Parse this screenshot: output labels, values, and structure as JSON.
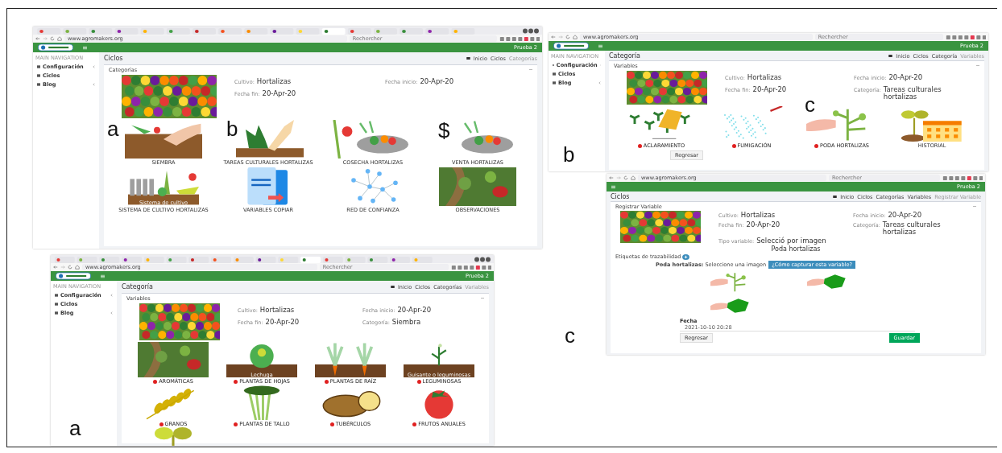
{
  "annotations": [
    {
      "text": "a"
    },
    {
      "text": "b"
    },
    {
      "text": "$"
    },
    {
      "text": "b"
    },
    {
      "text": "c"
    },
    {
      "text": "c"
    },
    {
      "text": "a"
    }
  ],
  "panels": [
    {
      "kind": "categories",
      "tab_strip": true,
      "address": {
        "url": "www.agromakers.org",
        "search_placeholder": "Rechercher"
      },
      "header": {
        "logo": true,
        "user": "Prueba 2"
      },
      "sidebar": {
        "heading": "MAIN NAVIGATION",
        "items": [
          {
            "label": "Configuración",
            "expandable": true
          },
          {
            "label": "Ciclos",
            "expandable": false
          },
          {
            "label": "Blog",
            "expandable": true
          }
        ]
      },
      "page_title": "Ciclos",
      "breadcrumbs": [
        {
          "label": "Inicio",
          "current": false
        },
        {
          "label": "Ciclos",
          "current": false
        },
        {
          "label": "Categorías",
          "current": true
        }
      ],
      "card_title": "Categorías",
      "info": [
        {
          "label": "Cultivo:",
          "value": "Hortalizas"
        },
        {
          "label": "Fecha inicio:",
          "value": "20-Apr-20"
        },
        {
          "label": "Fecha fin:",
          "value": "20-Apr-20"
        }
      ],
      "items": [
        {
          "label": "SIEMBRA",
          "dot": false
        },
        {
          "label": "TAREAS CULTURALES HORTALIZAS",
          "dot": false
        },
        {
          "label": "COSECHA HORTALIZAS",
          "dot": false
        },
        {
          "label": "VENTA HORTALIZAS",
          "dot": false
        },
        {
          "label": "SISTEMA DE CULTIVO HORTALIZAS",
          "dot": false,
          "caption": "Sistema de cultivo"
        },
        {
          "label": "VARIABLES COPIAR",
          "dot": false
        },
        {
          "label": "RED DE CONFIANZA",
          "dot": false
        },
        {
          "label": "OBSERVACIONES",
          "dot": false
        }
      ]
    },
    {
      "kind": "variables",
      "tab_strip": false,
      "address": {
        "url": "www.agromakers.org",
        "search_placeholder": "Rechercher"
      },
      "header": {
        "logo": true,
        "user": "Prueba 2"
      },
      "sidebar": {
        "heading": "MAIN NAVIGATION",
        "items": [
          {
            "label": "Configuración",
            "expandable": true
          },
          {
            "label": "Ciclos",
            "expandable": false
          },
          {
            "label": "Blog",
            "expandable": true
          }
        ]
      },
      "page_title": "Categoría",
      "breadcrumbs": [
        {
          "label": "Inicio",
          "current": false
        },
        {
          "label": "Ciclos",
          "current": false
        },
        {
          "label": "Categoría",
          "current": false
        },
        {
          "label": "Variables",
          "current": true
        }
      ],
      "card_title": "Variables",
      "info": [
        {
          "label": "Cultivo:",
          "value": "Hortalizas"
        },
        {
          "label": "Fecha inicio:",
          "value": "20-Apr-20"
        },
        {
          "label": "Fecha fin:",
          "value": "20-Apr-20"
        },
        {
          "label": "Categoría:",
          "value": "Tareas culturales hortalizas"
        }
      ],
      "items": [
        {
          "label": "ACLARAMIENTO",
          "dot": true
        },
        {
          "label": "FUMIGACIÓN",
          "dot": true
        },
        {
          "label": "PODA HORTALIZAS",
          "dot": true
        },
        {
          "label": "HISTORIAL",
          "dot": false
        }
      ],
      "back_button": "Regresar"
    },
    {
      "kind": "register",
      "tab_strip": false,
      "address": {
        "url": "www.agromakers.org",
        "search_placeholder": "Rechercher"
      },
      "header": {
        "logo": false,
        "user": "Prueba 2"
      },
      "page_title": "Ciclos",
      "breadcrumbs": [
        {
          "label": "Inicio",
          "current": false
        },
        {
          "label": "Ciclos",
          "current": false
        },
        {
          "label": "Categorías",
          "current": false
        },
        {
          "label": "Variables",
          "current": false
        },
        {
          "label": "Registrar Variable",
          "current": true
        }
      ],
      "card_title": "Registrar Variable",
      "info": [
        {
          "label": "Cultivo:",
          "value": "Hortalizas"
        },
        {
          "label": "Fecha inicio:",
          "value": "20-Apr-20"
        },
        {
          "label": "Fecha fin:",
          "value": "20-Apr-20"
        },
        {
          "label": "Categoría:",
          "value": "Tareas culturales hortalizas"
        },
        {
          "label": "Tipo variable:",
          "value": "Selecció por imagen"
        }
      ],
      "variable_title": "Poda hortalizas",
      "tags_label": "Etiquetas de trazabilidad",
      "prompt": {
        "label": "Poda hortalizas:",
        "hint": "Seleccione una imagen"
      },
      "help_button": "¿Cómo capturar esta variable?",
      "options": [
        {
          "selected": false
        },
        {
          "selected": false
        },
        {
          "selected": false
        }
      ],
      "date": {
        "label": "Fecha",
        "value": "2021-10-10 20:28"
      },
      "back_button": "Regresar",
      "save_button": "Guardar"
    },
    {
      "kind": "variables",
      "tab_strip": true,
      "address": {
        "url": "www.agromakers.org",
        "search_placeholder": "Rechercher"
      },
      "header": {
        "logo": true,
        "user": "Prueba 2"
      },
      "sidebar": {
        "heading": "MAIN NAVIGATION",
        "items": [
          {
            "label": "Configuración",
            "expandable": true
          },
          {
            "label": "Ciclos",
            "expandable": false
          },
          {
            "label": "Blog",
            "expandable": true
          }
        ]
      },
      "page_title": "Categoría",
      "breadcrumbs": [
        {
          "label": "Inicio",
          "current": false
        },
        {
          "label": "Ciclos",
          "current": false
        },
        {
          "label": "Categorías",
          "current": false
        },
        {
          "label": "Variables",
          "current": true
        }
      ],
      "card_title": "Variables",
      "info": [
        {
          "label": "Cultivo:",
          "value": "Hortalizas"
        },
        {
          "label": "Fecha inicio:",
          "value": "20-Apr-20"
        },
        {
          "label": "Fecha fin:",
          "value": "20-Apr-20"
        },
        {
          "label": "Categoría:",
          "value": "Siembra"
        }
      ],
      "items": [
        {
          "label": "AROMÁTICAS",
          "dot": true
        },
        {
          "label": "PLANTAS DE HOJAS",
          "dot": true,
          "caption": "Lechuga"
        },
        {
          "label": "PLANTAS DE RAÍZ",
          "dot": true
        },
        {
          "label": "LEGUMINOSAS",
          "dot": true,
          "caption": "Guisante o leguminosas"
        },
        {
          "label": "GRANOS",
          "dot": true
        },
        {
          "label": "PLANTAS DE TALLO",
          "dot": true
        },
        {
          "label": "TUBÉRCULOS",
          "dot": true
        },
        {
          "label": "FRUTOS ANUALES",
          "dot": true
        },
        {
          "dot": false
        }
      ]
    }
  ]
}
